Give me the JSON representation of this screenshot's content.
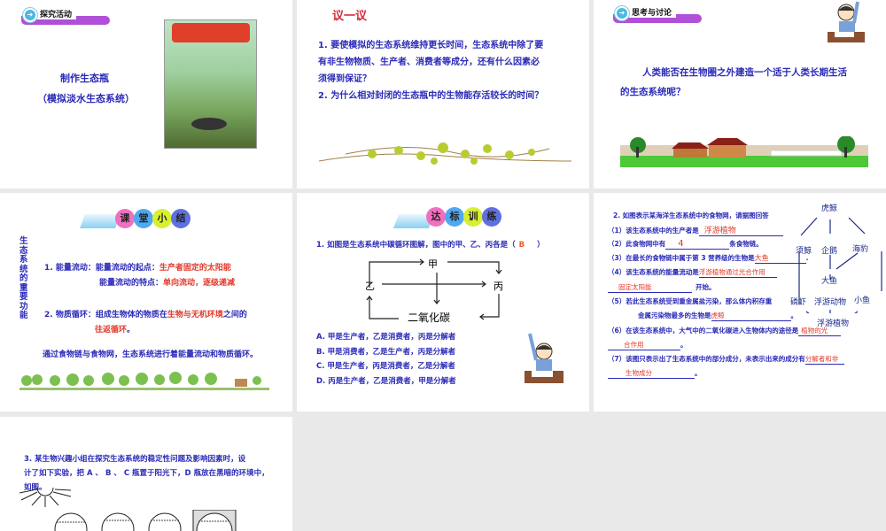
{
  "slides": [
    {
      "banner": "探究活动",
      "title": "制作生态瓶",
      "subtitle": "（模拟淡水生态系统）"
    },
    {
      "heading": "议一议",
      "lines": [
        "1. 要使模拟的生态系统维持更长时间，生态系统中除了要",
        "有非生物物质、生产者、消费者等成分，还有什么因素必",
        "须得到保证？",
        "2. 为什么相对封闭的生态瓶中的生物能存活较长的时间？"
      ]
    },
    {
      "banner": "思考与讨论",
      "lines": [
        "人类能否在生物圈之外建造一个适于人类长期生活",
        "的生态系统呢？"
      ]
    },
    {
      "banner_chars": [
        "课",
        "堂",
        "小",
        "结"
      ],
      "side": "生态系统的重要功能",
      "p1_label": "1. 能量流动：",
      "p1a": "能量流动的起点：",
      "p1a_red": "生产者固定的太阳能",
      "p1b": "能量流动的特点：",
      "p1b_red": "单向流动，逐级递减",
      "p2_label": "2. 物质循环：",
      "p2a": "组成生物体的物质在",
      "p2a_red": "生物与无机环境",
      "p2a_end": "之间的",
      "p2b_red": "往返循环",
      "p2b_end": "。",
      "footer": "通过食物链与食物网，生态系统进行着能量流动和物质循环。"
    },
    {
      "banner_chars": [
        "达",
        "标",
        "训",
        "练"
      ],
      "question": "1. 如图是生态系统中碳循环图解，图中的甲、乙、丙各是（",
      "answer": "B",
      "q_end": "）",
      "nodes": {
        "jia": "甲",
        "yi": "乙",
        "bing": "丙",
        "co2": "二氧化碳"
      },
      "options": [
        "A. 甲是生产者，乙是消费者，丙是分解者",
        "B. 甲是消费者，乙是生产者，丙是分解者",
        "C. 甲是生产者，丙是消费者，乙是分解者",
        "D. 丙是生产者，乙是消费者，甲是分解者"
      ]
    },
    {
      "title": "2. 如图表示某海洋生态系统中的食物网，请据图回答",
      "q1": "（1）该生态系统中的生产者是",
      "a1": "浮游植物",
      "q2": "（2）此食物网中有",
      "a2": "4",
      "q2_end": "条食物链。",
      "q3": "（3）在最长的食物链中属于第 3 营养级的生物是",
      "a3": "大鱼",
      "q4": "（4）该生态系统的能量流动是",
      "a4a": "浮游植物通过光合作用",
      "a4b": "固定太阳能",
      "q4_end": "开始。",
      "q5a": "（5）若此生态系统受到重金属盐污染，那么体内积存重",
      "q5b": "金属污染物最多的生物是",
      "a5": "虎鲸",
      "q6": "（6）在该生态系统中，大气中的二氧化碳进入生物体内的途径是",
      "a6a": "植物的光",
      "a6b": "合作用",
      "q7": "（7）该图只表示出了生态系统中的部分成分，未表示出来的成分有",
      "a7a": "分解者和非",
      "a7b": "生物成分",
      "web": {
        "orca": "虎鲸",
        "baleen": "须鲸",
        "penguin": "企鹅",
        "seal": "海豹",
        "bigfish": "大鱼",
        "krill": "磷虾",
        "zoo": "浮游动物",
        "smallfish": "小鱼",
        "phyto": "浮游植物"
      }
    },
    {
      "lines": [
        "3. 某生物兴趣小组在探究生态系统的稳定性问题及影响因素时，设",
        "计了如下实验，把 A 、 B 、 C 瓶置于阳光下，D 瓶放在黑暗的环境中，",
        "如图。"
      ]
    }
  ]
}
